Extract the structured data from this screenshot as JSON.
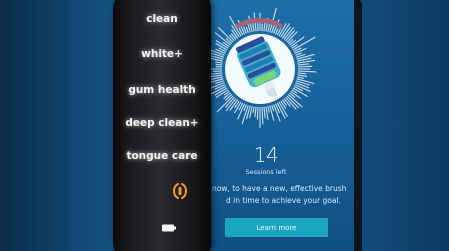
{
  "handle": {
    "modes": [
      "clean",
      "white+",
      "gum health",
      "deep clean+",
      "tongue care"
    ],
    "icons": [
      "brush-head-sync-icon",
      "battery-icon"
    ],
    "accent_color": "#f29a2e"
  },
  "app": {
    "sessions_count": "14",
    "sessions_label": "Sessions left",
    "message_lines": [
      "now, to have a new, effective brush",
      "d in time to achieve your goal."
    ],
    "button_label": "Learn more",
    "button_color": "#1aa5c3",
    "ring_progress_color": "#a4637a",
    "icons": [
      "brush-head-icon"
    ]
  }
}
